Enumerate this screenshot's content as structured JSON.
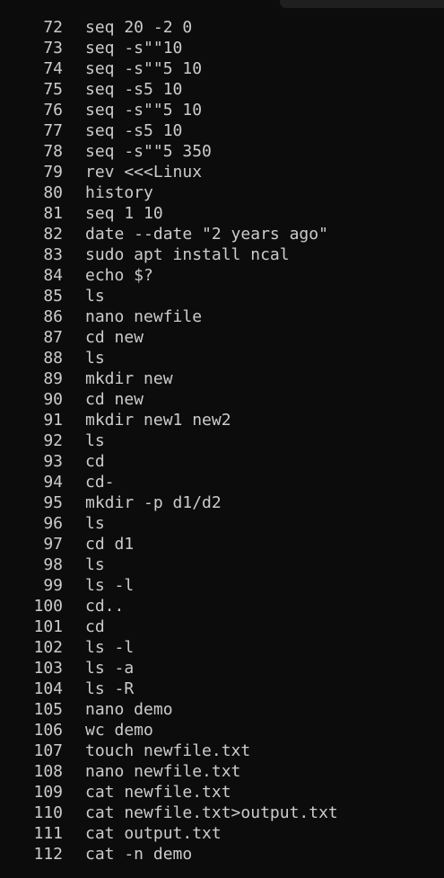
{
  "history": [
    {
      "num": "72",
      "cmd": "seq 20 -2 0"
    },
    {
      "num": "73",
      "cmd": "seq -s\"\"10"
    },
    {
      "num": "74",
      "cmd": "seq -s\"\"5 10"
    },
    {
      "num": "75",
      "cmd": "seq -s5 10"
    },
    {
      "num": "76",
      "cmd": "seq -s\"\"5 10"
    },
    {
      "num": "77",
      "cmd": "seq -s5 10"
    },
    {
      "num": "78",
      "cmd": "seq -s\"\"5 350"
    },
    {
      "num": "79",
      "cmd": "rev <<<Linux"
    },
    {
      "num": "80",
      "cmd": "history"
    },
    {
      "num": "81",
      "cmd": "seq 1 10"
    },
    {
      "num": "82",
      "cmd": "date --date \"2 years ago\""
    },
    {
      "num": "83",
      "cmd": "sudo apt install ncal"
    },
    {
      "num": "84",
      "cmd": "echo $?"
    },
    {
      "num": "85",
      "cmd": "ls"
    },
    {
      "num": "86",
      "cmd": "nano newfile"
    },
    {
      "num": "87",
      "cmd": "cd new"
    },
    {
      "num": "88",
      "cmd": "ls"
    },
    {
      "num": "89",
      "cmd": "mkdir new"
    },
    {
      "num": "90",
      "cmd": "cd new"
    },
    {
      "num": "91",
      "cmd": "mkdir new1 new2"
    },
    {
      "num": "92",
      "cmd": "ls"
    },
    {
      "num": "93",
      "cmd": "cd"
    },
    {
      "num": "94",
      "cmd": "cd-"
    },
    {
      "num": "95",
      "cmd": "mkdir -p d1/d2"
    },
    {
      "num": "96",
      "cmd": "ls"
    },
    {
      "num": "97",
      "cmd": "cd d1"
    },
    {
      "num": "98",
      "cmd": "ls"
    },
    {
      "num": "99",
      "cmd": "ls -l"
    },
    {
      "num": "100",
      "cmd": "cd.."
    },
    {
      "num": "101",
      "cmd": "cd"
    },
    {
      "num": "102",
      "cmd": "ls -l"
    },
    {
      "num": "103",
      "cmd": "ls -a"
    },
    {
      "num": "104",
      "cmd": "ls -R"
    },
    {
      "num": "105",
      "cmd": "nano demo"
    },
    {
      "num": "106",
      "cmd": "wc demo"
    },
    {
      "num": "107",
      "cmd": "touch newfile.txt"
    },
    {
      "num": "108",
      "cmd": "nano newfile.txt"
    },
    {
      "num": "109",
      "cmd": "cat newfile.txt"
    },
    {
      "num": "110",
      "cmd": "cat newfile.txt>output.txt"
    },
    {
      "num": "111",
      "cmd": "cat output.txt"
    },
    {
      "num": "112",
      "cmd": "cat -n demo"
    }
  ],
  "colors": {
    "background": "#0c0c0c",
    "text": "#cccccc",
    "tab_strip": "#1f1f1f"
  }
}
